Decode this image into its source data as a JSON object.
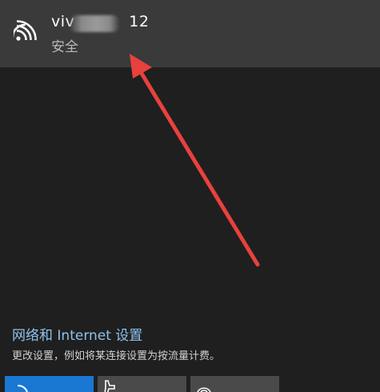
{
  "network": {
    "name_prefix": "viv",
    "name_suffix": "12",
    "status": "安全",
    "icon": "wifi-icon"
  },
  "settings": {
    "link_label": "网络和 Internet 设置",
    "description": "更改设置，例如将某连接设置为按流量计费。"
  },
  "tiles": [
    {
      "icon": "wifi-icon",
      "active": true
    },
    {
      "icon": "airplane-icon",
      "active": false
    },
    {
      "icon": "hotspot-icon",
      "active": false
    }
  ],
  "colors": {
    "background": "#1f1f1f",
    "selected_row": "#3a3a3a",
    "link": "#8fc2ec",
    "accent_tile": "#1a78d2",
    "annotation": "#e8413d"
  }
}
